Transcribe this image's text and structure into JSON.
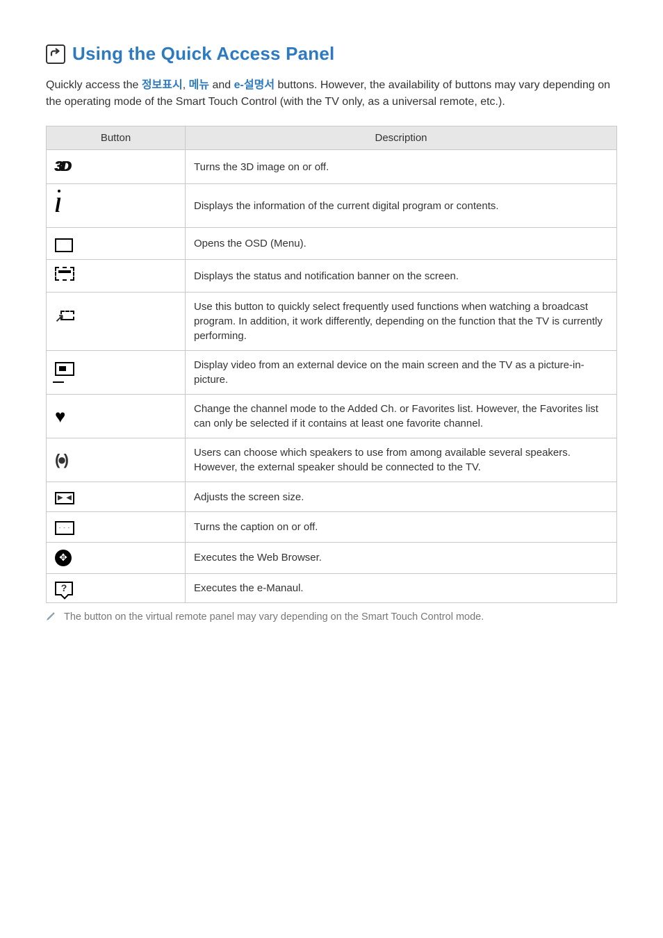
{
  "title": "Using the Quick Access Panel",
  "intro": {
    "prefix": "Quickly access the ",
    "hl1": "정보표시",
    "sep1": ", ",
    "hl2": "메뉴",
    "sep2": " and ",
    "hl3": "e-설명서",
    "suffix": " buttons. However, the availability of buttons may vary depending on the operating mode of the Smart Touch Control (with the TV only, as a universal remote, etc.)."
  },
  "headers": {
    "button": "Button",
    "description": "Description"
  },
  "rows": [
    {
      "icon": "3d",
      "desc": "Turns the 3D image on or off."
    },
    {
      "icon": "info",
      "desc": "Displays the information of the current digital program or contents."
    },
    {
      "icon": "menu",
      "desc": "Opens the OSD (Menu)."
    },
    {
      "icon": "banner",
      "desc": "Displays the status and notification banner on the screen."
    },
    {
      "icon": "quick",
      "desc": "Use this button to quickly select frequently used functions when watching a broadcast program. In addition, it work differently, depending on the function that the TV is currently performing."
    },
    {
      "icon": "pip",
      "desc": "Display video from an external device on the main screen and the TV as a picture-in-picture."
    },
    {
      "icon": "heart",
      "desc": "Change the channel mode to the Added Ch. or Favorites list. However, the Favorites list can only be selected if it contains at least one favorite channel."
    },
    {
      "icon": "speaker",
      "desc": "Users can choose which speakers to use from among available several speakers. However, the external speaker should be connected to the TV."
    },
    {
      "icon": "size",
      "desc": "Adjusts the screen size."
    },
    {
      "icon": "caption",
      "desc": "Turns the caption on or off."
    },
    {
      "icon": "web",
      "desc": "Executes the Web Browser."
    },
    {
      "icon": "emanual",
      "desc": "Executes the e-Manaul."
    }
  ],
  "glyphs": {
    "3d": "3D",
    "info": "l",
    "speaker": "(●)",
    "size_left": "▶",
    "size_right": "◀",
    "caption": "- - -",
    "web": "✥",
    "emanual": "?",
    "quick_arrow": "↗",
    "heart": "♥"
  },
  "note": "The button on the virtual remote panel may vary depending on the Smart Touch Control mode."
}
